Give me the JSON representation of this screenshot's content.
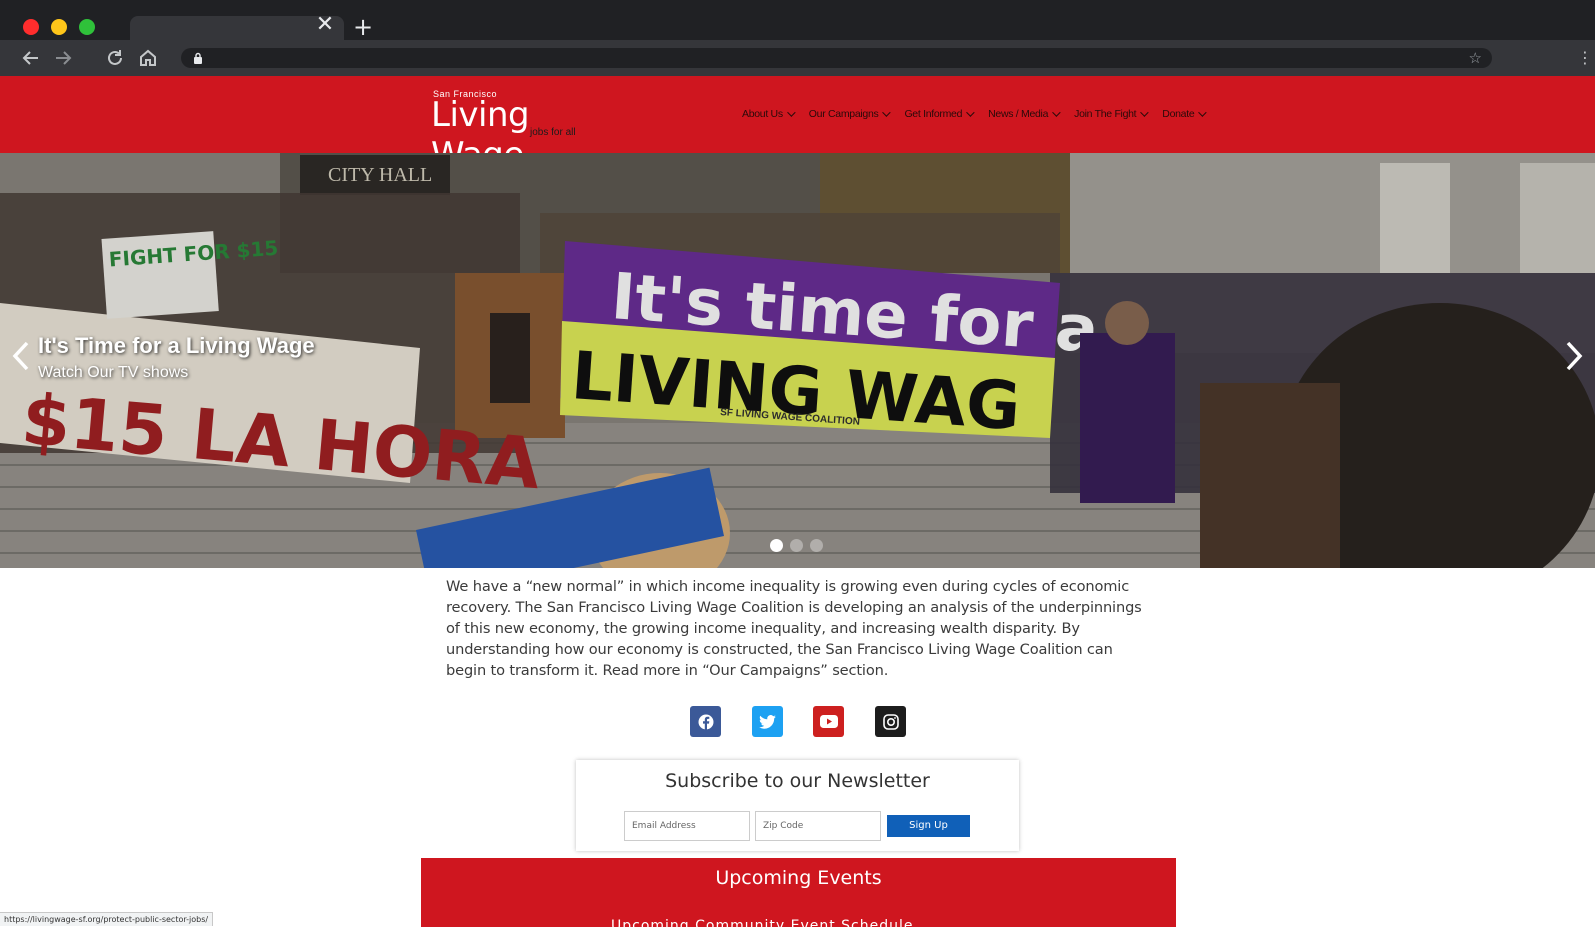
{
  "browser": {
    "tab_close_glyph": "✕",
    "new_tab_glyph": "+",
    "status_url": "https://livingwage-sf.org/protect-public-sector-jobs/",
    "icons": [
      "back-icon",
      "forward-icon",
      "reload-icon",
      "home-icon",
      "lock-icon",
      "star-icon",
      "menu-icon"
    ]
  },
  "header": {
    "logo_small": "San Francisco",
    "logo_main": "Living Wage",
    "logo_tag": "jobs for all",
    "brand_color": "#cf161f",
    "nav": [
      {
        "label": "About Us"
      },
      {
        "label": "Our Campaigns"
      },
      {
        "label": "Get Informed"
      },
      {
        "label": "News / Media"
      },
      {
        "label": "Join The Fight"
      },
      {
        "label": "Donate"
      }
    ]
  },
  "hero": {
    "title": "It's Time for a Living Wage",
    "subtitle": "Watch Our TV shows",
    "slide_count": 3,
    "active_slide": 1,
    "scene_text": {
      "building": "CITY HALL",
      "banner_line1": "It's time for a",
      "banner_line2": "LIVING WAG",
      "banner_credit": "SF LIVING WAGE COALITION",
      "sign_fight": "FIGHT FOR $15",
      "sign_hora": "$15 LA HORA"
    }
  },
  "intro": {
    "text": "We have a “new normal” in which income inequality is growing even during cycles of economic recovery. The San Francisco Living Wage Coalition is developing an analysis of the underpinnings of this new economy, the growing income inequality, and increasing wealth disparity. By understanding how our economy is constructed, the San Francisco Living Wage Coalition can begin to transform it. Read more in “Our Campaigns” section."
  },
  "social": {
    "items": [
      {
        "name": "facebook-icon",
        "color": "#3b5998"
      },
      {
        "name": "twitter-icon",
        "color": "#1da1f2"
      },
      {
        "name": "youtube-icon",
        "color": "#cd201f"
      },
      {
        "name": "instagram-icon",
        "color": "#1d1d1d"
      }
    ]
  },
  "newsletter": {
    "title": "Subscribe to our Newsletter",
    "email_placeholder": "Email Address",
    "zip_placeholder": "Zip Code",
    "button": "Sign Up",
    "button_color": "#1060b8"
  },
  "events": {
    "title": "Upcoming Events",
    "peek_text": "Upcoming Community Event Schedule"
  }
}
